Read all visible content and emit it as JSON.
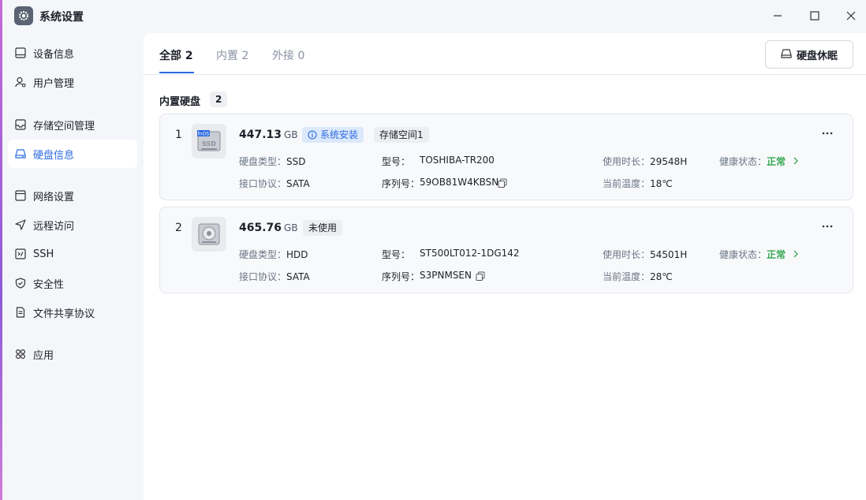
{
  "window": {
    "title": "系统设置"
  },
  "sidebar": {
    "items": [
      {
        "label": "设备信息",
        "icon": "monitor-icon"
      },
      {
        "label": "用户管理",
        "icon": "user-gear-icon"
      },
      {
        "label": "存储空间管理",
        "icon": "storage-tray-icon"
      },
      {
        "label": "硬盘信息",
        "icon": "disk-icon",
        "active": true
      },
      {
        "label": "网络设置",
        "icon": "network-window-icon"
      },
      {
        "label": "远程访问",
        "icon": "send-arrow-icon"
      },
      {
        "label": "SSH",
        "icon": "terminal-icon"
      },
      {
        "label": "安全性",
        "icon": "shield-check-icon"
      },
      {
        "label": "文件共享协议",
        "icon": "document-icon"
      },
      {
        "label": "应用",
        "icon": "apps-grid-icon"
      }
    ]
  },
  "tabs": [
    {
      "label": "全部 2",
      "active": true
    },
    {
      "label": "内置 2"
    },
    {
      "label": "外接 0"
    }
  ],
  "toolbar": {
    "sleep_label": "硬盘休眠"
  },
  "section": {
    "title": "内置硬盘",
    "count": "2"
  },
  "labels": {
    "type": "硬盘类型：",
    "interface": "接口协议：",
    "model": "型号：",
    "serial": "序列号：",
    "hours": "使用时长：",
    "temp": "当前温度：",
    "health": "健康状态："
  },
  "disks": [
    {
      "index": "1",
      "capacity": "447.13",
      "unit": "GB",
      "badges": [
        "系统安装",
        "存储空间1"
      ],
      "type": "SSD",
      "interface": "SATA",
      "model": "TOSHIBA-TR200",
      "serial": "59OB81W4KBSN",
      "hours": "29548H",
      "temp": "18℃",
      "health": "正常",
      "thumb_label": "SSD",
      "brand_tag": "fnOS"
    },
    {
      "index": "2",
      "capacity": "465.76",
      "unit": "GB",
      "badges": [
        "未使用"
      ],
      "type": "HDD",
      "interface": "SATA",
      "model": "ST500LT012-1DG142",
      "serial": "S3PNMSEN",
      "hours": "54501H",
      "temp": "28℃",
      "health": "正常"
    }
  ],
  "colors": {
    "accent": "#2c6be0",
    "ok": "#35a853"
  }
}
